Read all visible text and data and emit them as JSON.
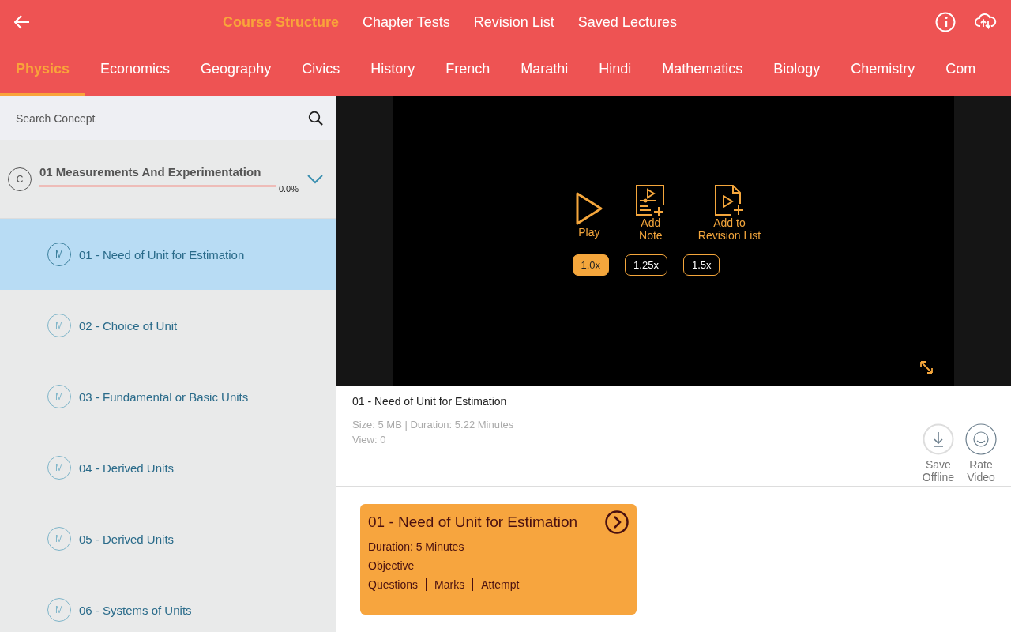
{
  "top_tabs": [
    {
      "label": "Course Structure",
      "selected": true
    },
    {
      "label": "Chapter Tests",
      "selected": false
    },
    {
      "label": "Revision List",
      "selected": false
    },
    {
      "label": "Saved Lectures",
      "selected": false
    }
  ],
  "subjects": [
    {
      "label": "Physics",
      "selected": true
    },
    {
      "label": "Economics",
      "selected": false
    },
    {
      "label": "Geography",
      "selected": false
    },
    {
      "label": "Civics",
      "selected": false
    },
    {
      "label": "History",
      "selected": false
    },
    {
      "label": "French",
      "selected": false
    },
    {
      "label": "Marathi",
      "selected": false
    },
    {
      "label": "Hindi",
      "selected": false
    },
    {
      "label": "Mathematics",
      "selected": false
    },
    {
      "label": "Biology",
      "selected": false
    },
    {
      "label": "Chemistry",
      "selected": false
    },
    {
      "label": "Com",
      "selected": false
    }
  ],
  "search": {
    "placeholder": "Search Concept"
  },
  "chapter": {
    "badge": "C",
    "title": "01 Measurements And Experimentation",
    "level": 0,
    "percent": "0.0%",
    "expanded": true
  },
  "lessons": [
    {
      "badge": "M",
      "title": "01 - Need of Unit for Estimation",
      "selected": true
    },
    {
      "badge": "M",
      "title": "02 - Choice of Unit",
      "selected": false
    },
    {
      "badge": "M",
      "title": "03 - Fundamental or Basic Units",
      "selected": false
    },
    {
      "badge": "M",
      "title": "04 - Derived Units",
      "selected": false
    },
    {
      "badge": "M",
      "title": "05 - Derived Units",
      "selected": false
    },
    {
      "badge": "M",
      "title": "06 - Systems of Units",
      "selected": false
    }
  ],
  "player": {
    "actions": [
      {
        "kind": "play",
        "label": "Play"
      },
      {
        "kind": "note",
        "label": "Add\nNote"
      },
      {
        "kind": "revision",
        "label": "Add to\nRevision List"
      }
    ],
    "speeds": [
      {
        "label": "1.0x",
        "selected": true
      },
      {
        "label": "1.25x",
        "selected": false
      },
      {
        "label": "1.5x",
        "selected": false
      }
    ]
  },
  "video_info": {
    "title": "01 - Need of Unit for Estimation",
    "meta": "Size: 5 MB | Duration: 5.22 Minutes",
    "views": "View: 0",
    "actions": [
      {
        "kind": "download",
        "label": "Save\nOffline"
      },
      {
        "kind": "rate",
        "label": "Rate\nVideo"
      }
    ]
  },
  "test_card": {
    "title": "01 - Need of Unit for Estimation",
    "duration": "Duration: 5 Minutes",
    "type": "Objective",
    "columns": [
      "Questions",
      "Marks",
      "Attempt"
    ]
  }
}
